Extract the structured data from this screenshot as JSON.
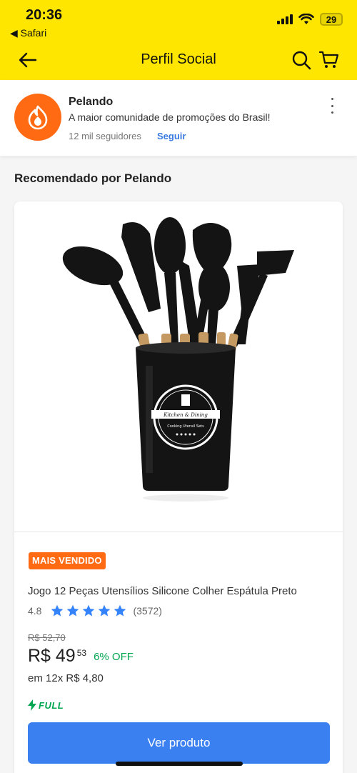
{
  "status_bar": {
    "time": "20:36",
    "back_app": "◀ Safari",
    "battery": "29"
  },
  "nav": {
    "title": "Perfil Social",
    "back_icon": "arrow-left-icon",
    "search_icon": "search-icon",
    "cart_icon": "cart-icon"
  },
  "profile": {
    "name": "Pelando",
    "description": "A maior comunidade de promoções do Brasil!",
    "followers": "12 mil seguidores",
    "follow_label": "Seguir",
    "avatar_icon": "flame-icon",
    "menu_icon": "more-vertical-icon"
  },
  "section": {
    "title": "Recomendado por Pelando"
  },
  "product": {
    "image_icon": "kitchen-utensil-set-image",
    "image_label_1": "Kitchen & Dining",
    "image_label_2": "Cooking Utensil Sets",
    "badge": "MAIS VENDIDO",
    "title": "Jogo 12 Peças Utensílios Silicone Colher Espátula Preto",
    "rating": "4.8",
    "rating_stars": 5,
    "rating_count": "(3572)",
    "old_price": "R$ 52,70",
    "price_main": "R$ 49",
    "price_cents": "53",
    "discount": "6% OFF",
    "installments": "em 12x R$ 4,80",
    "full_label": "FULL",
    "cta_label": "Ver produto"
  },
  "colors": {
    "brand_yellow": "#ffe600",
    "brand_orange": "#ff6a13",
    "link_blue": "#3a7ae0",
    "cta_blue": "#3a80f0",
    "green": "#00a650",
    "star_blue": "#3483fa"
  }
}
